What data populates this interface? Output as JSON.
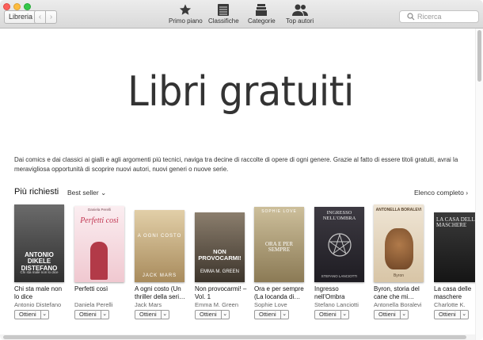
{
  "titlebar": {
    "library_label": "Libreria",
    "back_label": "‹",
    "forward_label": "›",
    "tabs": [
      {
        "label": "Primo piano",
        "icon": "star-icon"
      },
      {
        "label": "Classifiche",
        "icon": "list-icon"
      },
      {
        "label": "Categorie",
        "icon": "categories-icon"
      },
      {
        "label": "Top autori",
        "icon": "authors-icon"
      }
    ],
    "search_placeholder": "Ricerca"
  },
  "hero": {
    "title": "Libri gratuiti"
  },
  "description": "Dai comics e dai classici ai gialli e agli argomenti più tecnici, naviga tra decine di raccolte di opere di ogni genere. Grazie al fatto di essere titoli gratuiti, avrai la meravigliosa opportunità di scoprire nuovi autori, nuovi generi o nuove serie.",
  "section": {
    "title": "Più richiesti",
    "sort_label": "Best seller",
    "sort_chevron": "⌄",
    "all_label": "Elenco completo",
    "all_chevron": "›"
  },
  "get_label": "Ottieni",
  "get_chevron": "⌄",
  "books": [
    {
      "title": "Chi sta male non lo dice",
      "author": "Antonio Distefano",
      "cover_text": "ANTONIO DIKELE DISTEFANO",
      "cover_sub": "Chi sta male non lo dice",
      "bg": "#4a4a4a"
    },
    {
      "title": "Perfetti così",
      "author": "Daniela Perelli",
      "cover_text": "Perfetti così",
      "cover_sub": "Daniela Perelli",
      "bg": "#f5dde3"
    },
    {
      "title": "A ogni costo (Un thriller della seri…",
      "author": "Jack Mars",
      "cover_text": "A OGNI COSTO",
      "cover_sub": "JACK MARS",
      "bg": "#c9b08a"
    },
    {
      "title": "Non provocarmi! – Vol. 1",
      "author": "Emma M. Green",
      "cover_text": "NON PROVOCARMI!",
      "cover_sub": "EMMA M. GREEN",
      "bg": "#5e5448"
    },
    {
      "title": "Ora e per sempre (La locanda di…",
      "author": "Sophie Love",
      "cover_text": "ORA E PER SEMPRE",
      "cover_sub": "SOPHIE LOVE",
      "bg": "#b8a882"
    },
    {
      "title": "Ingresso nell'Ombra",
      "author": "Stefano Lanciotti",
      "cover_text": "INGRESSO NELL'OMBRA",
      "cover_sub": "STEFANO LANCIOTTI",
      "bg": "#2c2a30"
    },
    {
      "title": "Byron, storia del cane che mi…",
      "author": "Antonella Boralevi",
      "cover_text": "ANTONELLA BORALEVI",
      "cover_sub": "Byron",
      "bg": "#e6d8c3"
    },
    {
      "title": "La casa delle maschere",
      "author": "Charlotte K.",
      "cover_text": "LA CASA DELLE MASCHERE",
      "cover_sub": "",
      "bg": "#2b2b2b"
    }
  ]
}
